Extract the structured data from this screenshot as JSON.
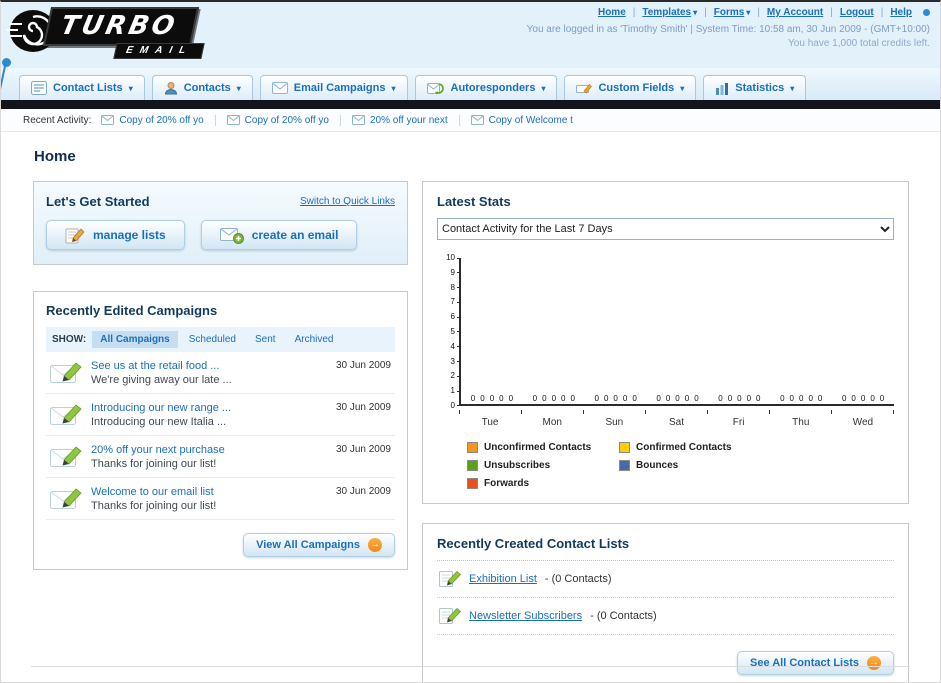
{
  "icons": {
    "caret_down": "▾",
    "arrow_right": "→"
  },
  "header": {
    "logo": {
      "line1": "TURBO",
      "line2": "EMAIL"
    },
    "links": [
      "Home",
      "Templates",
      "Forms",
      "My Account",
      "Logout",
      "Help"
    ],
    "login_info": "You are logged in as 'Timothy Smith' | System Time: 10:58 am, 30 Jun 2009 - (GMT+10:00)",
    "credits": "You have 1,000 total credits left."
  },
  "nav": {
    "items": [
      {
        "label": "Contact Lists"
      },
      {
        "label": "Contacts"
      },
      {
        "label": "Email Campaigns"
      },
      {
        "label": "Autoresponders"
      },
      {
        "label": "Custom Fields"
      },
      {
        "label": "Statistics"
      }
    ]
  },
  "recent_activity": {
    "label": "Recent Activity:",
    "items": [
      {
        "label": "Copy of 20% off yo"
      },
      {
        "label": "Copy of 20% off yo"
      },
      {
        "label": "20% off your next"
      },
      {
        "label": "Copy of Welcome t"
      }
    ]
  },
  "page": {
    "title": "Home"
  },
  "get_started": {
    "title": "Let's Get Started",
    "switch_link": "Switch to Quick Links",
    "manage_lists_button": "manage lists",
    "create_email_button": "create an email"
  },
  "campaigns": {
    "title": "Recently Edited Campaigns",
    "show_label": "SHOW:",
    "tabs": [
      {
        "label": "All Campaigns"
      },
      {
        "label": "Scheduled"
      },
      {
        "label": "Sent"
      },
      {
        "label": "Archived"
      }
    ],
    "items": [
      {
        "title": "See us at the retail food ...",
        "subtitle": "We're giving away our late ...",
        "date": "30 Jun 2009"
      },
      {
        "title": "Introducing our new range ...",
        "subtitle": "Introducing our new Italia ...",
        "date": "30 Jun 2009"
      },
      {
        "title": "20% off your next purchase",
        "subtitle": "Thanks for joining our list!",
        "date": "30 Jun 2009"
      },
      {
        "title": "Welcome to our email list",
        "subtitle": "Thanks for joining our list!",
        "date": "30 Jun 2009"
      }
    ],
    "view_all_button": "View All Campaigns"
  },
  "stats": {
    "title": "Latest Stats",
    "selected_filter": "Contact Activity for the Last 7 Days",
    "chart_data": {
      "type": "bar",
      "title": "Contact Activity for the Last 7 Days",
      "categories": [
        "Tue",
        "Mon",
        "Sun",
        "Sat",
        "Fri",
        "Thu",
        "Wed"
      ],
      "series": [
        {
          "name": "Unconfirmed Contacts",
          "color": "#f7941d",
          "values": [
            0,
            0,
            0,
            0,
            0,
            0,
            0
          ]
        },
        {
          "name": "Confirmed Contacts",
          "color": "#ffcc00",
          "values": [
            0,
            0,
            0,
            0,
            0,
            0,
            0
          ]
        },
        {
          "name": "Unsubscribes",
          "color": "#5aa117",
          "values": [
            0,
            0,
            0,
            0,
            0,
            0,
            0
          ]
        },
        {
          "name": "Bounces",
          "color": "#4a69a5",
          "values": [
            0,
            0,
            0,
            0,
            0,
            0,
            0
          ]
        },
        {
          "name": "Forwards",
          "color": "#e8501e",
          "values": [
            0,
            0,
            0,
            0,
            0,
            0,
            0
          ]
        }
      ],
      "ylim": [
        0,
        10
      ],
      "ytick_step": 1,
      "grid": false,
      "legend_position": "bottom"
    }
  },
  "contact_lists": {
    "title": "Recently Created Contact Lists",
    "items": [
      {
        "name": "Exhibition List",
        "detail": "- (0 Contacts)"
      },
      {
        "name": "Newsletter Subscribers",
        "detail": "- (0 Contacts)"
      }
    ],
    "see_all_button": "See All Contact Lists"
  }
}
